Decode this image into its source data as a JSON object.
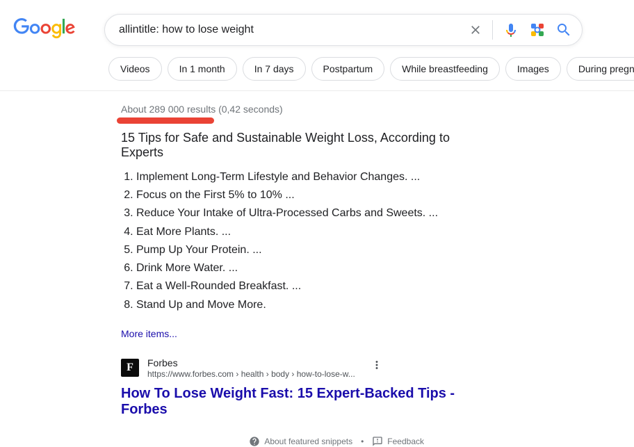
{
  "search": {
    "query": "allintitle: how to lose weight"
  },
  "chips": [
    "Videos",
    "In 1 month",
    "In 7 days",
    "Postpartum",
    "While breastfeeding",
    "Images",
    "During pregnancy"
  ],
  "stats": "About 289 000 results (0,42 seconds)",
  "snippet": {
    "title": "15 Tips for Safe and Sustainable Weight Loss, According to Experts",
    "items": [
      "Implement Long-Term Lifestyle and Behavior Changes. ...",
      "Focus on the First 5% to 10% ...",
      "Reduce Your Intake of Ultra-Processed Carbs and Sweets. ...",
      "Eat More Plants. ...",
      "Pump Up Your Protein. ...",
      "Drink More Water. ...",
      "Eat a Well-Rounded Breakfast. ...",
      "Stand Up and Move More."
    ],
    "more": "More items..."
  },
  "result": {
    "favicon_letter": "F",
    "source_name": "Forbes",
    "source_url": "https://www.forbes.com › health › body › how-to-lose-w...",
    "title": "How To Lose Weight Fast: 15 Expert-Backed Tips - Forbes"
  },
  "footer": {
    "about": "About featured snippets",
    "feedback": "Feedback"
  }
}
